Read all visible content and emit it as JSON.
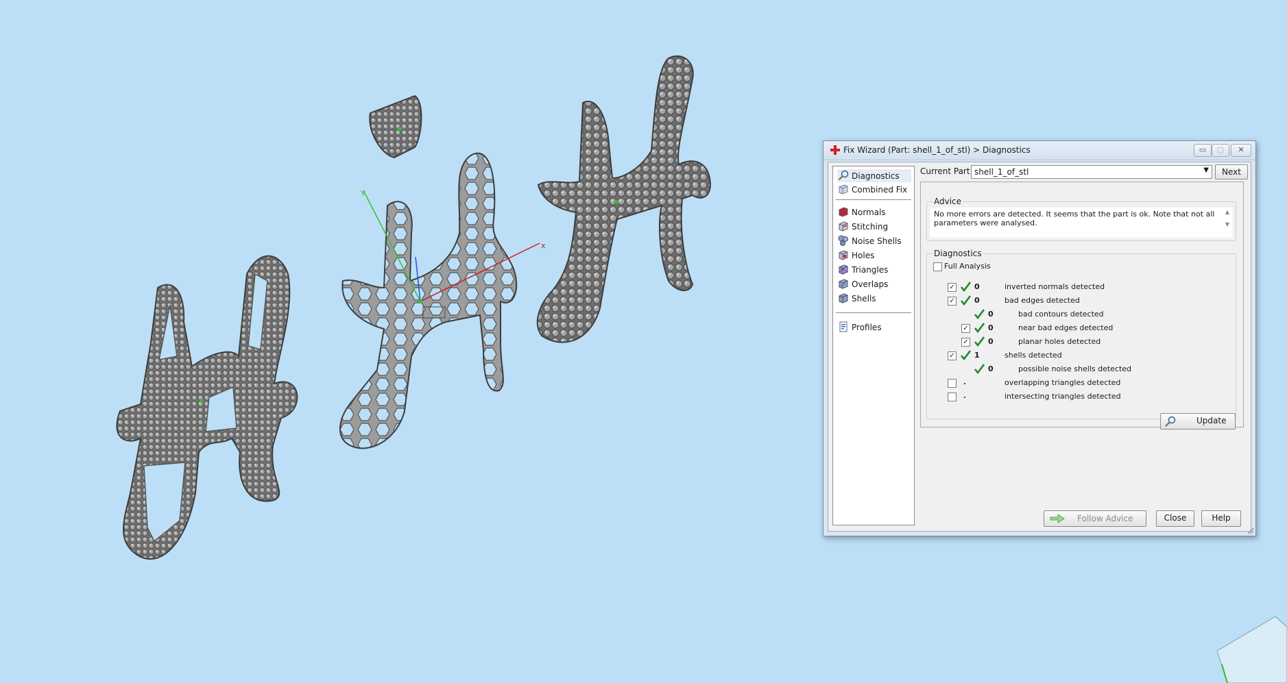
{
  "dialog": {
    "title": "Fix Wizard (Part: shell_1_of_stl) > Diagnostics",
    "buttons": {
      "minimize": "▭",
      "maximize": "▢",
      "close": "✕"
    }
  },
  "sidebar": {
    "items": [
      {
        "label": "Diagnostics",
        "icon": "magnifier-icon",
        "selected": true
      },
      {
        "label": "Combined Fix",
        "icon": "cube-icon"
      },
      {
        "label": "Normals",
        "icon": "normals-cube-icon"
      },
      {
        "label": "Stitching",
        "icon": "stitching-cube-icon"
      },
      {
        "label": "Noise Shells",
        "icon": "noise-shells-icon"
      },
      {
        "label": "Holes",
        "icon": "holes-cube-icon"
      },
      {
        "label": "Triangles",
        "icon": "triangles-cube-icon"
      },
      {
        "label": "Overlaps",
        "icon": "overlaps-cube-icon"
      },
      {
        "label": "Shells",
        "icon": "shells-cube-icon"
      },
      {
        "label": "Profiles",
        "icon": "profiles-icon"
      }
    ]
  },
  "main": {
    "current_part_label": "Current Part:",
    "current_part_value": "shell_1_of_stl",
    "next_label": "Next"
  },
  "advice": {
    "legend": "Advice",
    "text": "No more errors are detected. It seems that the part is ok. Note that not all parameters were analysed."
  },
  "diagnostics": {
    "legend": "Diagnostics",
    "full_analysis_label": "Full Analysis",
    "rows": [
      {
        "label": "inverted normals detected",
        "value": "0",
        "checked": true
      },
      {
        "label": "bad edges detected",
        "value": "0",
        "checked": true
      },
      {
        "label": "bad contours detected",
        "value": "0"
      },
      {
        "label": "near bad edges detected",
        "value": "0",
        "checked": true
      },
      {
        "label": "planar holes detected",
        "value": "0",
        "checked": true
      },
      {
        "label": "shells detected",
        "value": "1",
        "checked": true
      },
      {
        "label": "possible noise shells detected",
        "value": "0"
      },
      {
        "label": "overlapping triangles detected",
        "value": "",
        "checked": false
      },
      {
        "label": "intersecting triangles detected",
        "value": "",
        "checked": false
      }
    ],
    "update_label": "Update"
  },
  "footer": {
    "follow_advice_label": "Follow Advice",
    "close_label": "Close",
    "help_label": "Help"
  },
  "viewport": {
    "axis_labels": {
      "x": "x",
      "y": "Y"
    },
    "background_color": "#bcdff7"
  },
  "colors": {
    "check_green": "#1f8a2a",
    "model_gray": "#8c8c8c"
  }
}
